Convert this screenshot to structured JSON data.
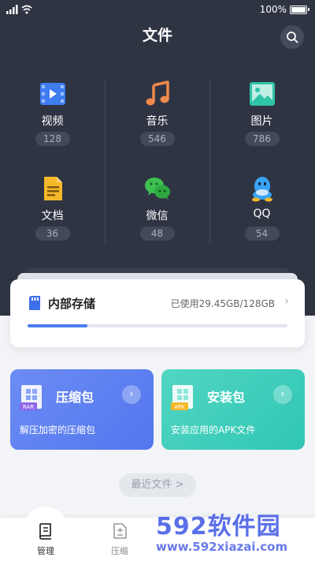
{
  "status": {
    "battery_text": "100%"
  },
  "header": {
    "title": "文件",
    "search_icon": "search-icon"
  },
  "categories": [
    {
      "label": "视频",
      "count": "128",
      "icon": "video-icon",
      "color": "#3d7cf1"
    },
    {
      "label": "音乐",
      "count": "546",
      "icon": "music-icon",
      "color": "#f08a4b"
    },
    {
      "label": "图片",
      "count": "786",
      "icon": "image-icon",
      "color": "#2fc3a8"
    },
    {
      "label": "文档",
      "count": "36",
      "icon": "document-icon",
      "color": "#f5b82a"
    },
    {
      "label": "微信",
      "count": "48",
      "icon": "wechat-icon",
      "color": "#3cc04f"
    },
    {
      "label": "QQ",
      "count": "54",
      "icon": "qq-icon",
      "color": "#38a3f5"
    }
  ],
  "storage": {
    "title": "内部存储",
    "used_text": "已使用29.45GB/128GB",
    "used_fraction": 0.23,
    "accent": "#4a7df0"
  },
  "features": {
    "zip": {
      "title": "压缩包",
      "desc": "解压加密的压缩包",
      "badge": "RAR"
    },
    "apk": {
      "title": "安装包",
      "desc": "安装应用的APK文件",
      "badge": "APK"
    }
  },
  "recent": {
    "label": "最近文件 >"
  },
  "tabs": [
    {
      "label": "管理"
    },
    {
      "label": "压缩"
    }
  ],
  "watermark": {
    "brand": "592软件园",
    "url": "www.592xiazai.com"
  }
}
